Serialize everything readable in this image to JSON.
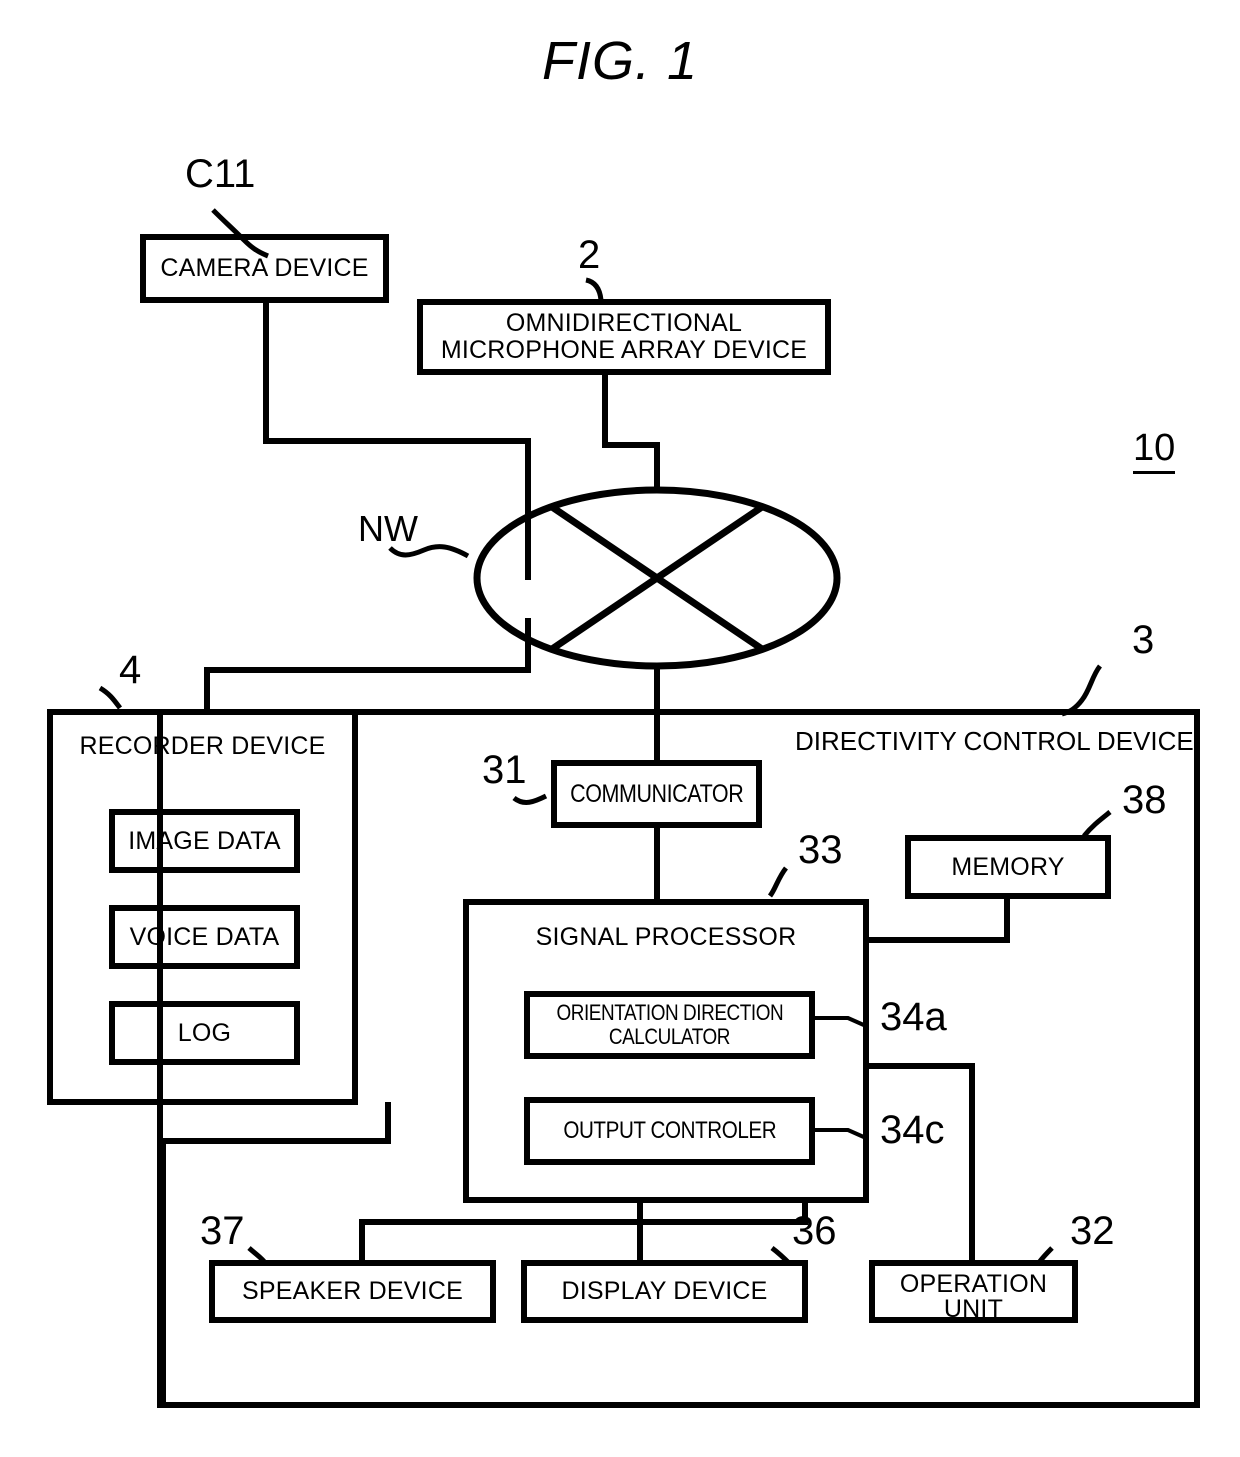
{
  "figure": {
    "title": "FIG. 1",
    "system_ref": "10"
  },
  "nodes": {
    "camera_device": {
      "label": "CAMERA DEVICE",
      "ref": "C11"
    },
    "mic_array": {
      "label_line1": "OMNIDIRECTIONAL",
      "label_line2": "MICROPHONE ARRAY DEVICE",
      "ref": "2"
    },
    "network": {
      "label": "NW"
    },
    "recorder_device": {
      "label": "RECORDER DEVICE",
      "ref": "4"
    },
    "image_data": {
      "label": "IMAGE DATA"
    },
    "voice_data": {
      "label": "VOICE DATA"
    },
    "log": {
      "label": "LOG"
    },
    "directivity_control_device": {
      "label": "DIRECTIVITY CONTROL DEVICE",
      "ref": "3"
    },
    "communicator": {
      "label": "COMMUNICATOR",
      "ref": "31"
    },
    "memory": {
      "label": "MEMORY",
      "ref": "38"
    },
    "signal_processor": {
      "label": "SIGNAL PROCESSOR",
      "ref": "33"
    },
    "orientation_direction_calculator": {
      "label_line1": "ORIENTATION DIRECTION",
      "label_line2": "CALCULATOR",
      "ref": "34a"
    },
    "output_controller": {
      "label": "OUTPUT CONTROLER",
      "ref": "34c"
    },
    "speaker_device": {
      "label": "SPEAKER DEVICE",
      "ref": "37"
    },
    "display_device": {
      "label": "DISPLAY DEVICE",
      "ref": "36"
    },
    "operation_unit": {
      "label_line1": "OPERATION",
      "label_line2": "UNIT",
      "ref": "32"
    }
  },
  "colors": {
    "stroke": "#000000",
    "background": "#ffffff"
  }
}
